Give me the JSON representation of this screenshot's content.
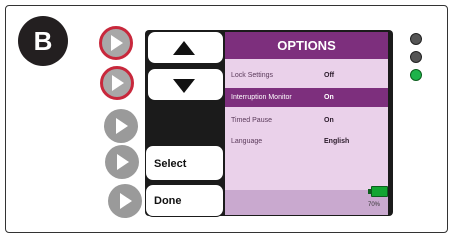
{
  "panel": {
    "label": "B"
  },
  "screen": {
    "title": "OPTIONS",
    "options": [
      {
        "label": "Lock Settings",
        "value": "Off",
        "selected": false
      },
      {
        "label": "Interruption Monitor",
        "value": "On",
        "selected": true
      },
      {
        "label": "Timed Pause",
        "value": "On",
        "selected": false
      },
      {
        "label": "Language",
        "value": "English",
        "selected": false
      }
    ],
    "battery": {
      "percent_label": "70%",
      "level": 0.7,
      "color": "#13a532"
    }
  },
  "soft_keys": {
    "up": {
      "icon": "up-arrow-icon"
    },
    "down": {
      "icon": "down-arrow-icon"
    },
    "select": {
      "label": "Select"
    },
    "done": {
      "label": "Done"
    }
  },
  "side_buttons": [
    {
      "icon": "play-icon",
      "highlighted": true
    },
    {
      "icon": "play-icon",
      "highlighted": true
    },
    {
      "icon": "play-icon",
      "highlighted": false
    },
    {
      "icon": "play-icon",
      "highlighted": false
    },
    {
      "icon": "play-icon",
      "highlighted": false
    }
  ],
  "indicator_lights": [
    {
      "state": "off",
      "color": "#555555"
    },
    {
      "state": "off",
      "color": "#555555"
    },
    {
      "state": "on",
      "color": "#1db34a"
    }
  ],
  "colors": {
    "header": "#7d2f7d",
    "screen_background": "#ead1ea",
    "highlight_ring": "#c8283c"
  }
}
